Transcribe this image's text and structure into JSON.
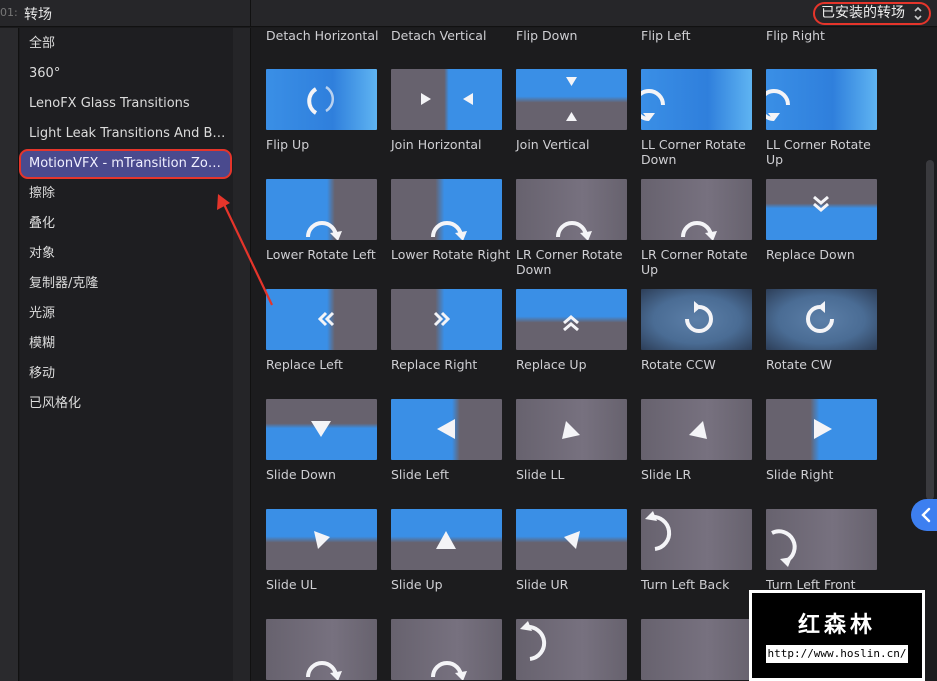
{
  "topbar": {
    "timecode": "01:",
    "title": "转场",
    "filter": "已安装的转场"
  },
  "sidebar": {
    "items": [
      {
        "label": "全部"
      },
      {
        "label": "360°"
      },
      {
        "label": "LenoFX Glass Transitions"
      },
      {
        "label": "Light Leak Transitions And Bur..."
      },
      {
        "label": "MotionVFX - mTransition Zoo...",
        "selected": true
      },
      {
        "label": "擦除"
      },
      {
        "label": "叠化"
      },
      {
        "label": "对象"
      },
      {
        "label": "复制器/克隆"
      },
      {
        "label": "光源"
      },
      {
        "label": "模糊"
      },
      {
        "label": "移动"
      },
      {
        "label": "已风格化"
      }
    ]
  },
  "grid": {
    "top_labels": [
      "Detach Horizontal",
      "Detach Vertical",
      "Flip Down",
      "Flip Left",
      "Flip Right"
    ],
    "rows": [
      [
        {
          "label": "Flip Up",
          "icon": "rotate-arc-icon",
          "style": "blue"
        },
        {
          "label": "Join Horizontal",
          "icon": "join-horizontal-icon",
          "style": "split"
        },
        {
          "label": "Join Vertical",
          "icon": "join-vertical-icon",
          "style": "hsplit"
        },
        {
          "label": "LL Corner Rotate Down",
          "icon": "corner-rotate-icon",
          "style": "blue"
        },
        {
          "label": "LL Corner Rotate Up",
          "icon": "corner-rotate-icon",
          "style": "blue"
        }
      ],
      [
        {
          "label": "Lower Rotate Left",
          "icon": "rotate-right-icon",
          "style": "bluegrey"
        },
        {
          "label": "Lower Rotate Right",
          "icon": "rotate-right-icon",
          "style": "greyblue"
        },
        {
          "label": "LR Corner Rotate Down",
          "icon": "rotate-right-icon",
          "style": "grey"
        },
        {
          "label": "LR Corner Rotate Up",
          "icon": "rotate-right-icon",
          "style": "grey"
        },
        {
          "label": "Replace Down",
          "icon": "double-chevron-down-icon",
          "style": "hsplit2"
        }
      ],
      [
        {
          "label": "Replace Left",
          "icon": "double-chevron-left-icon",
          "style": "bluegrey"
        },
        {
          "label": "Replace Right",
          "icon": "double-chevron-right-icon",
          "style": "greyblue"
        },
        {
          "label": "Replace Up",
          "icon": "double-chevron-up-icon",
          "style": "hsplit"
        },
        {
          "label": "Rotate CCW",
          "icon": "rotate-ccw-icon",
          "style": "round"
        },
        {
          "label": "Rotate CW",
          "icon": "rotate-cw-icon",
          "style": "round"
        }
      ],
      [
        {
          "label": "Slide Down",
          "icon": "arrow-down-icon",
          "style": "hsplit2"
        },
        {
          "label": "Slide Left",
          "icon": "arrow-left-icon",
          "style": "bluegrey"
        },
        {
          "label": "Slide LL",
          "icon": "arrow-ll-icon",
          "style": "grey"
        },
        {
          "label": "Slide LR",
          "icon": "arrow-lr-icon",
          "style": "grey"
        },
        {
          "label": "Slide Right",
          "icon": "arrow-right-icon",
          "style": "greyblue"
        }
      ],
      [
        {
          "label": "Slide UL",
          "icon": "arrow-ul-icon",
          "style": "hsplit"
        },
        {
          "label": "Slide Up",
          "icon": "arrow-up-icon",
          "style": "hsplit"
        },
        {
          "label": "Slide UR",
          "icon": "arrow-ur-icon",
          "style": "hsplit"
        },
        {
          "label": "Turn Left Back",
          "icon": "turn-back-icon",
          "style": "grey"
        },
        {
          "label": "Turn Left Front",
          "icon": "turn-front-icon",
          "style": "grey"
        }
      ],
      [
        {
          "label": "",
          "icon": "rotate-right-icon",
          "style": "grey"
        },
        {
          "label": "",
          "icon": "rotate-right-icon",
          "style": "grey"
        },
        {
          "label": "",
          "icon": "turn-back-icon",
          "style": "grey"
        },
        {
          "label": "",
          "icon": "",
          "style": "grey"
        },
        {
          "label": "",
          "icon": "rotate-right-icon",
          "style": "grey"
        }
      ]
    ]
  },
  "watermark": {
    "brand": "红森林",
    "url": "http://www.hoslin.cn/"
  },
  "colors": {
    "accent": "#3d7ff0",
    "highlight": "#e5352b",
    "selected_bg": "#4a4a8e",
    "thumb_blue": "#3a8fe6",
    "thumb_grey": "#67626e"
  }
}
